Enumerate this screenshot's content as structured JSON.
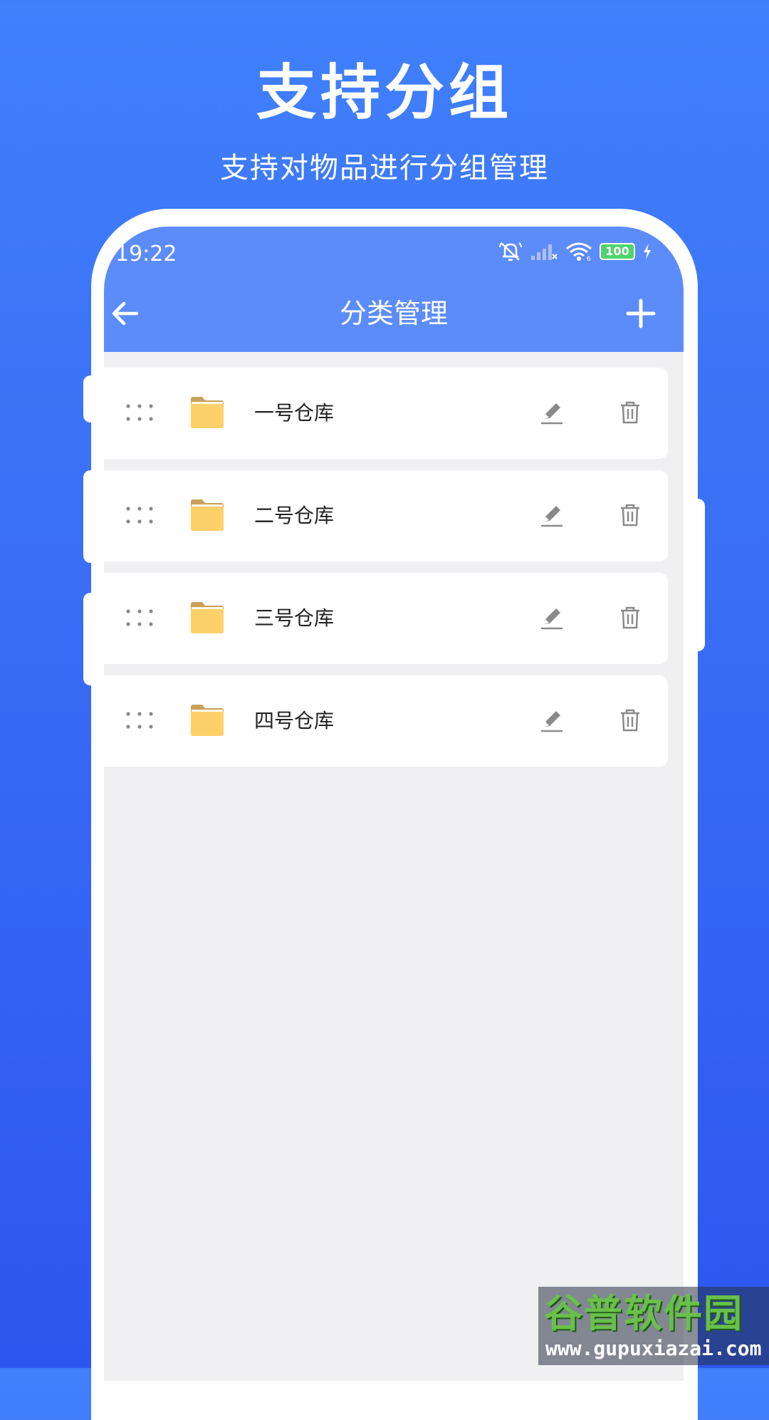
{
  "promo": {
    "title": "支持分组",
    "subtitle": "支持对物品进行分组管理"
  },
  "status_bar": {
    "time": "19:22",
    "battery": "100",
    "icons": [
      "mute-bell-icon",
      "signal-icon",
      "wifi-icon",
      "battery-icon",
      "charging-icon"
    ]
  },
  "header": {
    "title": "分类管理",
    "back_icon": "arrow-left-icon",
    "add_icon": "plus-icon"
  },
  "categories": [
    {
      "label": "一号仓库"
    },
    {
      "label": "二号仓库"
    },
    {
      "label": "三号仓库"
    },
    {
      "label": "四号仓库"
    }
  ],
  "watermark": {
    "name": "谷普软件园",
    "url": "www.gupuxiazai.com"
  },
  "colors": {
    "background_top": "#4080fb",
    "background_bottom": "#2d56f0",
    "header": "#5b8cfa",
    "folder": "#fdd06a",
    "list_background": "#f0f0f2"
  }
}
